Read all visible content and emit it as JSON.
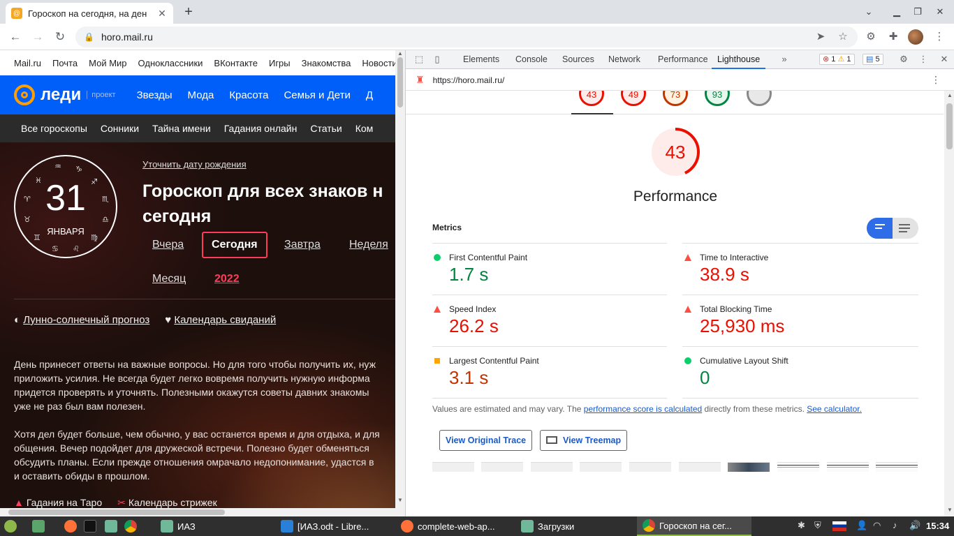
{
  "browser": {
    "tab_title": "Гороскоп на сегодня, на ден",
    "url": "horo.mail.ru"
  },
  "portal_links": [
    "Mail.ru",
    "Почта",
    "Мой Мир",
    "Одноклассники",
    "ВКонтакте",
    "Игры",
    "Знакомства",
    "Новости"
  ],
  "ledi": {
    "logo": "леди",
    "project": "проект",
    "nav": [
      "Звезды",
      "Мода",
      "Красота",
      "Семья и Дети",
      "Д"
    ]
  },
  "categories": [
    "Все гороскопы",
    "Сонники",
    "Тайна имени",
    "Гадания онлайн",
    "Статьи",
    "Ком"
  ],
  "zodiac": {
    "day": "31",
    "month": "ЯНВАРЯ",
    "signs": [
      "♒",
      "♑",
      "♐",
      "♏",
      "♎",
      "♍",
      "♌",
      "♋",
      "♊",
      "♉",
      "♈",
      "♓"
    ]
  },
  "horo": {
    "clarify": "Уточнить дату рождения",
    "title_line1": "Гороскоп для всех знаков н",
    "title_line2": "сегодня",
    "tabs": {
      "yesterday": "Вчера",
      "today": "Сегодня",
      "tomorrow": "Завтра",
      "week": "Неделя",
      "month": "Месяц",
      "year": "2022"
    },
    "link_lunar": "Лунно-солнечный прогноз",
    "link_dates": "Календарь свиданий",
    "para1": "День принесет ответы на важные вопросы. Но для того чтобы получить их, нуж\nприложить усилия. Не всегда будет легко вовремя получить нужную информа\nпридется проверять и уточнять. Полезными окажутся советы давних знакомы\nуже не раз был вам полезен.",
    "para2": "Хотя дел будет больше, чем обычно, у вас останется время и для отдыха, и для\nобщения. Вечер подойдет для дружеской встречи. Полезно будет обменяться\nобсудить планы. Если прежде отношения омрачало недопонимание, удастся в\nи оставить обиды в прошлом.",
    "bottom_tarot": "Гадания на Таро",
    "bottom_haircut": "Календарь стрижек"
  },
  "devtools": {
    "tabs": [
      "Elements",
      "Console",
      "Sources",
      "Network",
      "Performance",
      "Lighthouse"
    ],
    "errors": "1",
    "warnings": "1",
    "messages": "5",
    "report_url": "https://horo.mail.ru/"
  },
  "lighthouse": {
    "mini_scores": [
      {
        "value": "43",
        "color": "#eb0f00",
        "bg": "#fdecea"
      },
      {
        "value": "49",
        "color": "#eb0f00",
        "bg": "#fdecea"
      },
      {
        "value": "73",
        "color": "#c33300",
        "bg": "#fff3e0"
      },
      {
        "value": "93",
        "color": "#018642",
        "bg": "#e6f7ee"
      },
      {
        "value": "",
        "color": "#888888",
        "bg": "#e8e8e8"
      }
    ],
    "score": "43",
    "score_fraction": 0.43,
    "category": "Performance",
    "metrics_label": "Metrics",
    "metrics": [
      {
        "name": "First Contentful Paint",
        "value": "1.7 s",
        "rating": "pass"
      },
      {
        "name": "Time to Interactive",
        "value": "38.9 s",
        "rating": "fail"
      },
      {
        "name": "Speed Index",
        "value": "26.2 s",
        "rating": "fail"
      },
      {
        "name": "Total Blocking Time",
        "value": "25,930 ms",
        "rating": "fail"
      },
      {
        "name": "Largest Contentful Paint",
        "value": "3.1 s",
        "rating": "avg"
      },
      {
        "name": "Cumulative Layout Shift",
        "value": "0",
        "rating": "pass"
      }
    ],
    "note_prefix": "Values are estimated and may vary. The ",
    "note_link1": "performance score is calculated",
    "note_mid": " directly from these metrics. ",
    "note_link2": "See calculator.",
    "btn_trace": "View Original Trace",
    "btn_treemap": "View Treemap"
  },
  "taskbar": {
    "items": [
      "ИАЗ",
      "[ИАЗ.odt - Libre...",
      "complete-web-ap...",
      "Загрузки",
      "Гороскоп на сег..."
    ],
    "clock": "15:34"
  }
}
